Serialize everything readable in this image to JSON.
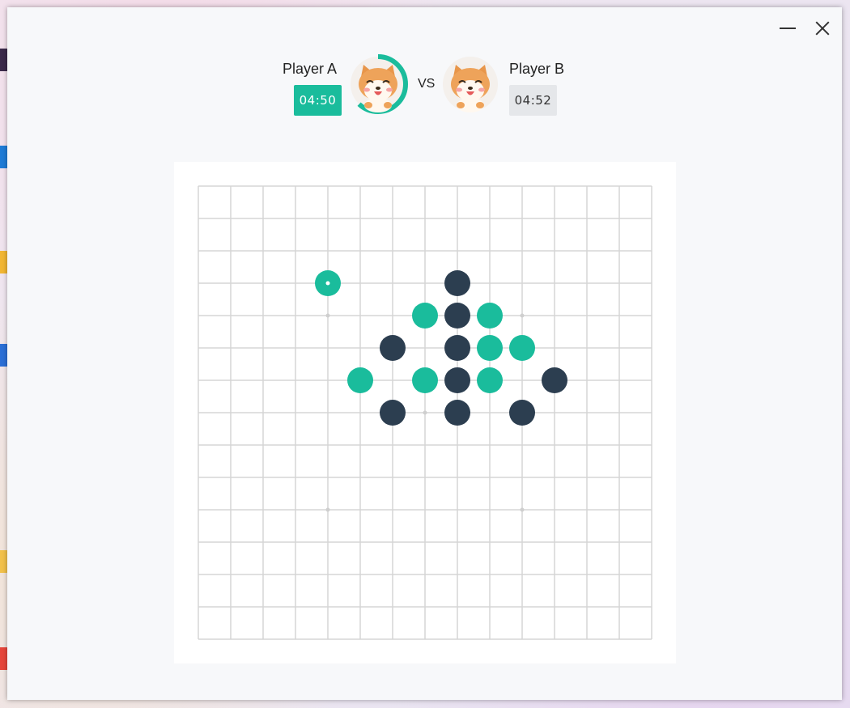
{
  "window": {
    "minimize_icon": "minimize-icon",
    "close_icon": "close-icon"
  },
  "players": {
    "a": {
      "name": "Player A",
      "time": "04:50",
      "active": true,
      "timer_progress": 0.62
    },
    "b": {
      "name": "Player B",
      "time": "04:52",
      "active": false
    }
  },
  "vs_label": "VS",
  "avatar_icon": "shiba-dog-avatar-icon",
  "colors": {
    "player_a_stone": "#1abc9c",
    "player_b_stone": "#2c3e50",
    "active_timer": "#1abc9c",
    "grid_line": "#d5d5d5"
  },
  "board": {
    "size": 15,
    "star_points": [
      [
        4,
        4
      ],
      [
        4,
        10
      ],
      [
        7,
        7
      ],
      [
        10,
        4
      ],
      [
        10,
        10
      ]
    ],
    "last_move": {
      "row": 3,
      "col": 4
    },
    "stones": [
      {
        "row": 3,
        "col": 4,
        "player": "A"
      },
      {
        "row": 3,
        "col": 8,
        "player": "B"
      },
      {
        "row": 4,
        "col": 7,
        "player": "A"
      },
      {
        "row": 4,
        "col": 8,
        "player": "B"
      },
      {
        "row": 4,
        "col": 9,
        "player": "A"
      },
      {
        "row": 5,
        "col": 6,
        "player": "B"
      },
      {
        "row": 5,
        "col": 8,
        "player": "B"
      },
      {
        "row": 5,
        "col": 9,
        "player": "A"
      },
      {
        "row": 5,
        "col": 10,
        "player": "A"
      },
      {
        "row": 6,
        "col": 5,
        "player": "A"
      },
      {
        "row": 6,
        "col": 7,
        "player": "A"
      },
      {
        "row": 6,
        "col": 8,
        "player": "B"
      },
      {
        "row": 6,
        "col": 9,
        "player": "A"
      },
      {
        "row": 6,
        "col": 11,
        "player": "B"
      },
      {
        "row": 7,
        "col": 6,
        "player": "B"
      },
      {
        "row": 7,
        "col": 8,
        "player": "B"
      },
      {
        "row": 7,
        "col": 10,
        "player": "B"
      }
    ]
  }
}
